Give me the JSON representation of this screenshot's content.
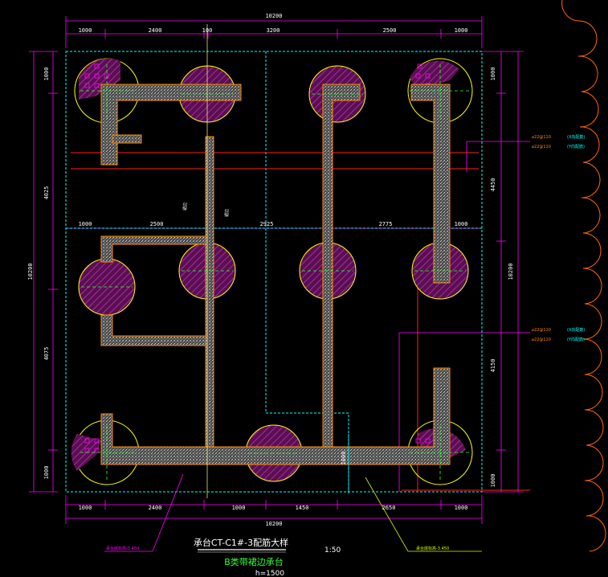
{
  "drawing": {
    "title": "承台CT-C1#-3配筋大样",
    "scale": "1:50",
    "subtitle": "B类带裙边承台",
    "height_label": "h=1500"
  },
  "dimensions": {
    "top_total": "10200",
    "top_segments": [
      "1000",
      "2400",
      "100",
      "3200",
      "2500",
      "1000"
    ],
    "mid_segments": [
      "1000",
      "2500",
      "2925",
      "2775",
      "1000"
    ],
    "bottom_segments": [
      "1000",
      "2400",
      "1000",
      "1450",
      "2650",
      "1000"
    ],
    "bottom_total": "10200",
    "left_total": "10200",
    "left_segments": [
      "1000",
      "4025",
      "4075",
      "1000"
    ],
    "right_total": "10200",
    "right_segments": [
      "1000",
      "4450",
      "4150",
      "1000"
    ],
    "inner_vertical": "1000"
  },
  "labels": {
    "rebar_a": "⌀22@110",
    "rebar_b": "⌀22@110",
    "rebar_note_a": "(X向配筋)",
    "rebar_note_b": "(Y向配筋)",
    "rebar_c": "⌀22@110",
    "rebar_d": "⌀22@110",
    "rebar_note_c": "(X向配筋)",
    "rebar_note_d": "(Y向配筋)",
    "mid_label_1": "裙边",
    "mid_label_2": "裙边",
    "leader_left": "承台底标高-3.450",
    "leader_right": "承台底标高-3.450"
  },
  "colors": {
    "background": "#000000",
    "dimension": "#ff00ff",
    "outline": "#00ffff",
    "pile_circle": "#ffff00",
    "hatch": "#9b1d8c",
    "beam_edge": "#ff8c00",
    "red_line": "#ff2020",
    "green": "#33ff33",
    "cloud": "#ff6600"
  }
}
